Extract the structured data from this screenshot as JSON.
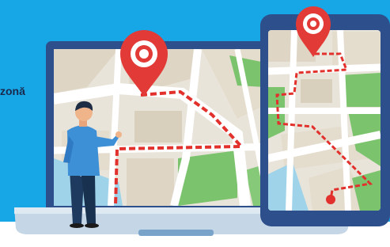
{
  "banner": {
    "left_text_fragment": "zonă",
    "right_text_fragment": ""
  },
  "colors": {
    "banner_blue": "#17a6e6",
    "device_frame": "#2d4f8c",
    "map_block_beige": "#e4dccd",
    "map_park_green": "#7cc36e",
    "map_water": "#9fd3ea",
    "route_red": "#e2312c",
    "pin_red": "#e23a36",
    "laptop_base": "#c5d6e6"
  },
  "icons": {
    "laptop_pin": "map-pin-icon",
    "tablet_pin": "map-pin-icon",
    "destination_dot": "location-dot-icon"
  }
}
